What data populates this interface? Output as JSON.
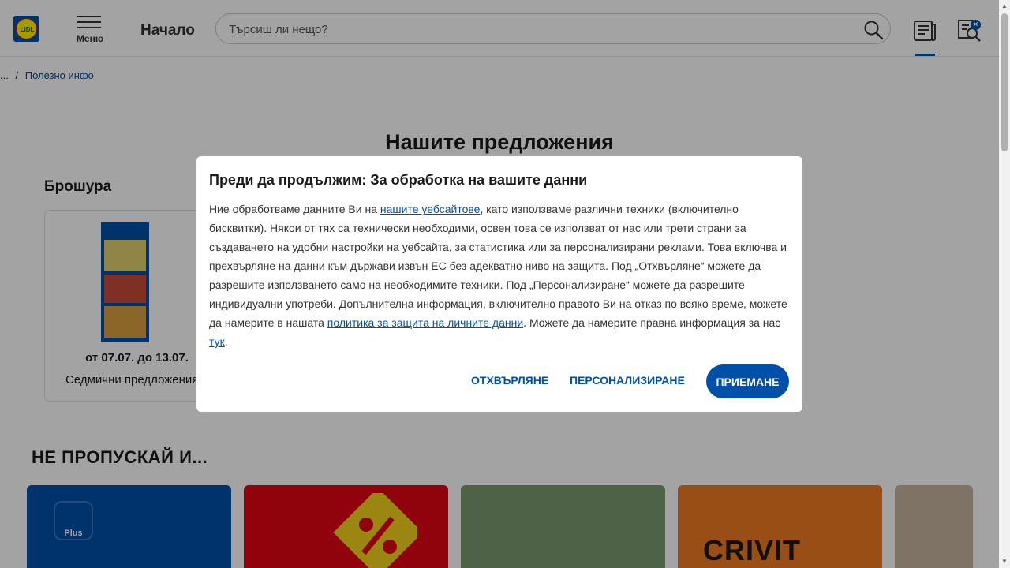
{
  "header": {
    "logo_text": "LIDL",
    "menu_label": "Меню",
    "home_label": "Начало",
    "search_placeholder": "Търсиш ли нещо?",
    "badge": "×",
    "colors": {
      "brand_blue": "#0050aa",
      "brand_yellow": "#fff200",
      "brand_red": "#e60a14"
    }
  },
  "breadcrumb": {
    "ellipsis": "...",
    "separator": "/",
    "current": "Полезно инфо"
  },
  "page_title": "Нашите предложения",
  "brochure": {
    "section_title": "Брошура",
    "dates": "от 07.07. до 13.07.",
    "name": "Седмични предложения"
  },
  "promo": {
    "title": "НЕ ПРОПУСКАЙ И...",
    "tile_texts": {
      "plus": "Plus",
      "crivit": "CRIVIT"
    }
  },
  "modal": {
    "title": "Преди да продължим: За обработка на вашите данни",
    "body_part1": "Ние обработваме данните Ви на ",
    "link_websites": "нашите уебсайтове",
    "body_part2": ", като използваме различни техники (включително бисквитки). Някои от тях са технически необходими, освен това се използват от нас или трети страни за създаването на удобни настройки на уебсайта, за статистика или за персонализирани реклами. Това включва и прехвърляне на данни към държави извън ЕС без адекватно ниво на защита. Под „Отхвърляне“ можете да разрешите използването само на необходимите техники. Под „Персонализиране“ можете да разрешите индивидуални употреби. Допълнителна информация, включително правото Ви на отказ по всяко време, можете да намерите в нашата ",
    "link_privacy": "политика за защита на личните данни",
    "body_part3": ". Можете да намерите правна информация за нас ",
    "link_here": "тук",
    "body_part4": ".",
    "reject_label": "Отхвърляне",
    "customize_label": "Персонализиране",
    "accept_label": "Приемане"
  }
}
